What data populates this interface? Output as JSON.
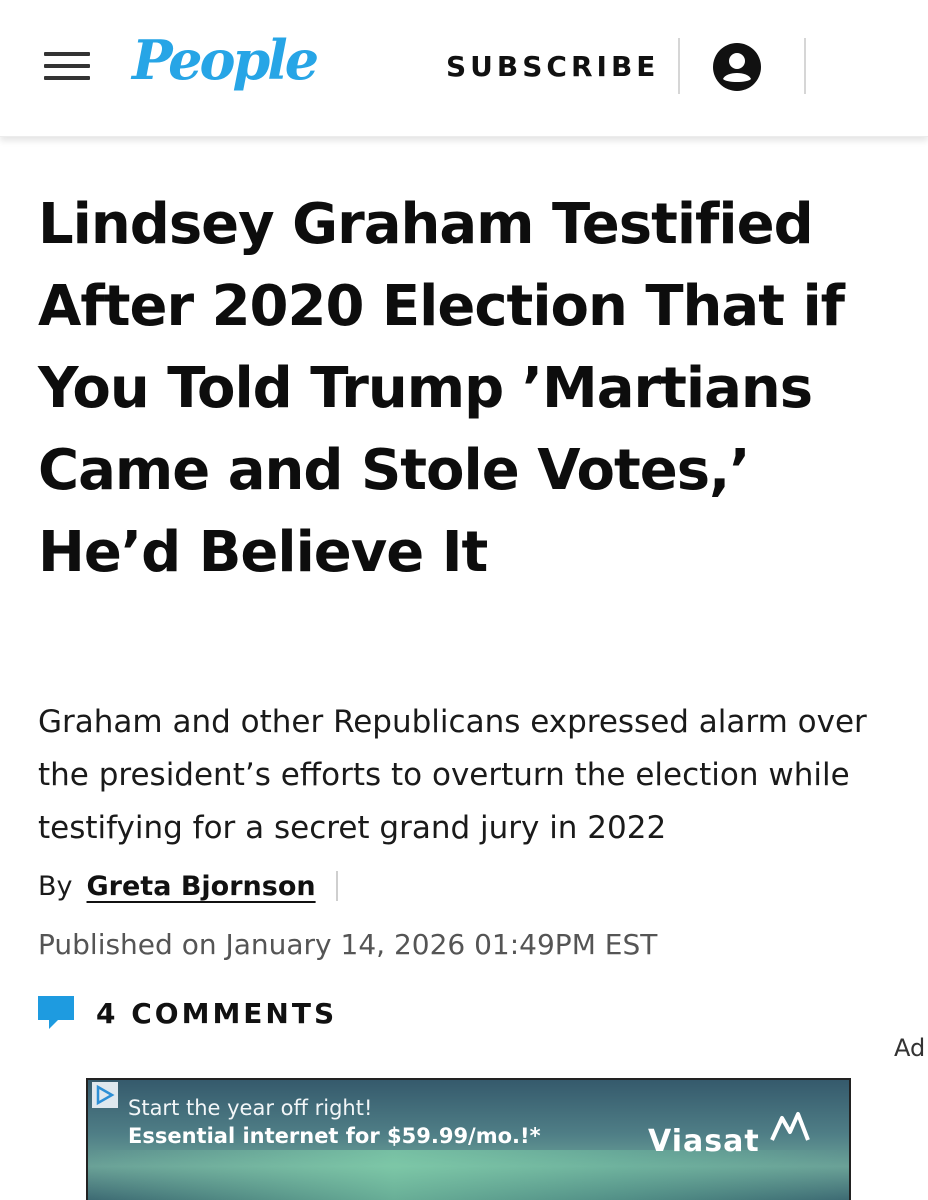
{
  "header": {
    "logo": "People",
    "subscribe_label": "SUBSCRIBE"
  },
  "article": {
    "headline": "Lindsey Graham Testified After 2020 Election That if You Told Trump ’Martians Came and Stole Votes,’ He’d Believe It",
    "subhead": "Graham and other Republicans expressed alarm over the president’s efforts to overturn the election while testifying for a secret grand jury in 2022",
    "byline_prefix": "By",
    "author": "Greta Bjornson",
    "published": "Published on January 14, 2026 01:49PM EST",
    "comments_label": "4 COMMENTS"
  },
  "ad": {
    "label": "Ad",
    "line1": "Start the year off right!",
    "line2": "Essential internet for $59.99/mo.!*",
    "brand": "Viasat"
  },
  "colors": {
    "brand_blue": "#27a5e6",
    "comment_icon": "#1e9be0",
    "text": "#111111"
  },
  "icons": [
    "menu-icon",
    "account-icon",
    "comment-icon",
    "ad-choices-icon"
  ]
}
